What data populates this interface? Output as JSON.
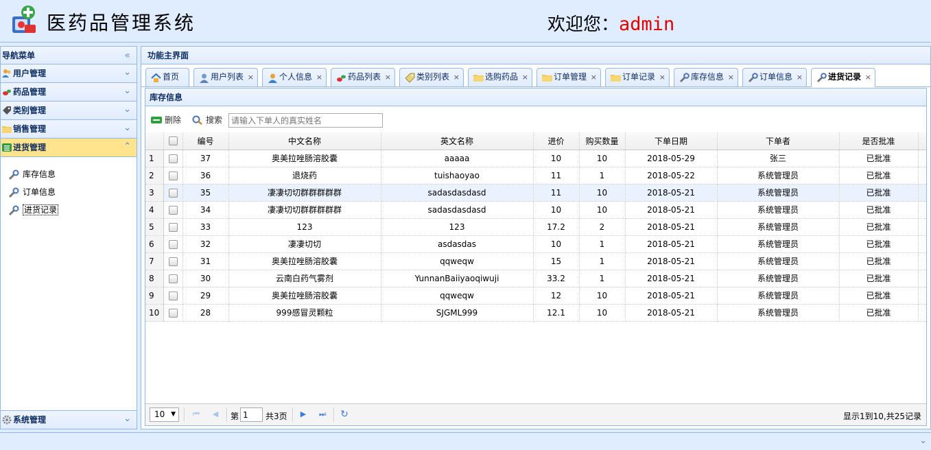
{
  "header": {
    "app_title": "医药品管理系统",
    "welcome_prefix": "欢迎您：",
    "username": "admin"
  },
  "nav": {
    "title": "导航菜单",
    "collapse_icon": "double-chevron-left-icon",
    "groups": [
      {
        "label": "用户管理",
        "icon": "users-icon",
        "expanded": false
      },
      {
        "label": "药品管理",
        "icon": "pills-icon",
        "expanded": false
      },
      {
        "label": "类别管理",
        "icon": "tag-icon",
        "expanded": false
      },
      {
        "label": "销售管理",
        "icon": "folder-icon",
        "expanded": false
      },
      {
        "label": "进货管理",
        "icon": "list-icon",
        "expanded": true
      }
    ],
    "active_items": [
      {
        "label": "库存信息",
        "icon": "wrench-icon"
      },
      {
        "label": "订单信息",
        "icon": "wrench-icon"
      },
      {
        "label": "进货记录",
        "icon": "wrench-icon",
        "selected": true
      }
    ],
    "system": {
      "label": "系统管理",
      "icon": "gear-icon"
    }
  },
  "main": {
    "title": "功能主界面",
    "tabs": [
      {
        "label": "首页",
        "icon": "home-icon",
        "closable": false
      },
      {
        "label": "用户列表",
        "icon": "user-icon",
        "closable": true
      },
      {
        "label": "个人信息",
        "icon": "user-icon",
        "closable": true
      },
      {
        "label": "药品列表",
        "icon": "pills-icon",
        "closable": true
      },
      {
        "label": "类别列表",
        "icon": "tag-icon",
        "closable": true
      },
      {
        "label": "选购药品",
        "icon": "folder-icon",
        "closable": true
      },
      {
        "label": "订单管理",
        "icon": "folder-icon",
        "closable": true
      },
      {
        "label": "订单记录",
        "icon": "folder-icon",
        "closable": true
      },
      {
        "label": "库存信息",
        "icon": "wrench-icon",
        "closable": true
      },
      {
        "label": "订单信息",
        "icon": "wrench-icon",
        "closable": true
      },
      {
        "label": "进货记录",
        "icon": "wrench-icon",
        "closable": true,
        "active": true
      }
    ],
    "close_glyph": "×"
  },
  "content": {
    "title": "库存信息",
    "toolbar": {
      "delete_label": "删除",
      "search_label": "搜索",
      "search_placeholder": "请输入下单人的真实姓名"
    },
    "columns": [
      "编号",
      "中文名称",
      "英文名称",
      "进价",
      "购买数量",
      "下单日期",
      "下单者",
      "是否批准"
    ],
    "rows": [
      {
        "n": "1",
        "id": "37",
        "cn": "奥美拉唑肠溶胶囊",
        "en": "aaaaa",
        "price": "10",
        "qty": "10",
        "date": "2018-05-29",
        "by": "张三",
        "ok": "已批准"
      },
      {
        "n": "2",
        "id": "36",
        "cn": "退烧药",
        "en": "tuishaoyao",
        "price": "11",
        "qty": "1",
        "date": "2018-05-22",
        "by": "系统管理员",
        "ok": "已批准"
      },
      {
        "n": "3",
        "id": "35",
        "cn": "凄凄切切群群群群群",
        "en": "sadasdasdasd",
        "price": "11",
        "qty": "10",
        "date": "2018-05-21",
        "by": "系统管理员",
        "ok": "已批准"
      },
      {
        "n": "4",
        "id": "34",
        "cn": "凄凄切切群群群群群",
        "en": "sadasdasdasd",
        "price": "10",
        "qty": "10",
        "date": "2018-05-21",
        "by": "系统管理员",
        "ok": "已批准"
      },
      {
        "n": "5",
        "id": "33",
        "cn": "123",
        "en": "123",
        "price": "17.2",
        "qty": "2",
        "date": "2018-05-21",
        "by": "系统管理员",
        "ok": "已批准"
      },
      {
        "n": "6",
        "id": "32",
        "cn": "凄凄切切",
        "en": "asdasdas",
        "price": "10",
        "qty": "1",
        "date": "2018-05-21",
        "by": "系统管理员",
        "ok": "已批准"
      },
      {
        "n": "7",
        "id": "31",
        "cn": "奥美拉唑肠溶胶囊",
        "en": "qqweqw",
        "price": "15",
        "qty": "1",
        "date": "2018-05-21",
        "by": "系统管理员",
        "ok": "已批准"
      },
      {
        "n": "8",
        "id": "30",
        "cn": "云南白药气雾剂",
        "en": "YunnanBaiiyaoqiwuji",
        "price": "33.2",
        "qty": "1",
        "date": "2018-05-21",
        "by": "系统管理员",
        "ok": "已批准"
      },
      {
        "n": "9",
        "id": "29",
        "cn": "奥美拉唑肠溶胶囊",
        "en": "qqweqw",
        "price": "12",
        "qty": "10",
        "date": "2018-05-21",
        "by": "系统管理员",
        "ok": "已批准"
      },
      {
        "n": "10",
        "id": "28",
        "cn": "999感冒灵颗粒",
        "en": "SJGML999",
        "price": "12.1",
        "qty": "10",
        "date": "2018-05-21",
        "by": "系统管理员",
        "ok": "已批准"
      }
    ],
    "highlighted_row": 3,
    "pager": {
      "page_size": "10",
      "page_label": "第",
      "current_page": "1",
      "total_pages": "共3页",
      "info": "显示1到10,共25记录"
    }
  },
  "colors": {
    "accent_blue": "#95b8e7",
    "header_bg": "#e0ecff",
    "selected_group": "#ffe48d",
    "username_red": "#e00000",
    "row_highlight": "#eaf2ff"
  }
}
